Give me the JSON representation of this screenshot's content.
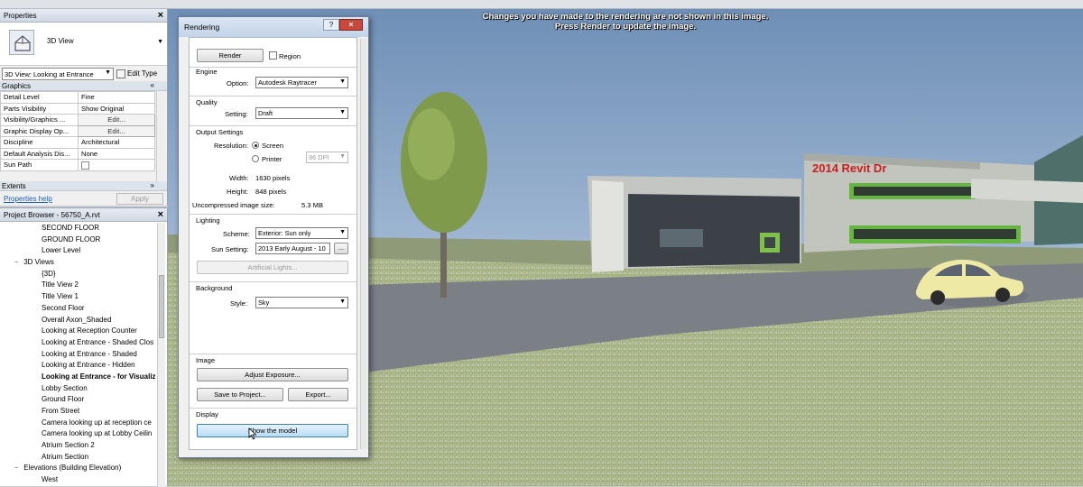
{
  "properties": {
    "title": "Properties",
    "type_name": "3D View",
    "view_selector": "3D View: Looking at Entrance",
    "edit_type": "Edit Type",
    "section_graphics": "Graphics",
    "rows": [
      {
        "key": "Detail Level",
        "value": "Fine"
      },
      {
        "key": "Parts Visibility",
        "value": "Show Original"
      },
      {
        "key": "Visibility/Graphics ...",
        "value": "Edit..."
      },
      {
        "key": "Graphic Display Op...",
        "value": "Edit..."
      },
      {
        "key": "Discipline",
        "value": "Architectural"
      },
      {
        "key": "Default Analysis Dis...",
        "value": "None"
      },
      {
        "key": "Sun Path",
        "value": ""
      }
    ],
    "section_extents": "Extents",
    "help_link": "Properties help",
    "apply": "Apply"
  },
  "browser": {
    "title": "Project Browser - 56750_A.rvt",
    "items": [
      {
        "label": "SECOND FLOOR",
        "indent": 3
      },
      {
        "label": "GROUND FLOOR",
        "indent": 3
      },
      {
        "label": "Lower Level",
        "indent": 3
      },
      {
        "label": "3D Views",
        "indent": 1,
        "toggle": "−"
      },
      {
        "label": "{3D}",
        "indent": 3
      },
      {
        "label": "Title View 2",
        "indent": 3
      },
      {
        "label": "Title View 1",
        "indent": 3
      },
      {
        "label": "Second Floor",
        "indent": 3
      },
      {
        "label": "Overall Axon_Shaded",
        "indent": 3
      },
      {
        "label": "Looking at Reception Counter",
        "indent": 3
      },
      {
        "label": "Looking at Entrance - Shaded Clos",
        "indent": 3
      },
      {
        "label": "Looking at Entrance - Shaded",
        "indent": 3
      },
      {
        "label": "Looking at Entrance - Hidden",
        "indent": 3
      },
      {
        "label": "Looking at Entrance - for Visualiz",
        "indent": 3,
        "bold": true
      },
      {
        "label": "Lobby Section",
        "indent": 3
      },
      {
        "label": "Ground Floor",
        "indent": 3
      },
      {
        "label": "From Street",
        "indent": 3
      },
      {
        "label": "Camera looking up at reception ce",
        "indent": 3
      },
      {
        "label": "Camera looking up at Lobby Ceilin",
        "indent": 3
      },
      {
        "label": "Atrium Section 2",
        "indent": 3
      },
      {
        "label": "Atrium Section",
        "indent": 3
      },
      {
        "label": "Elevations (Building Elevation)",
        "indent": 1,
        "toggle": "−"
      },
      {
        "label": "West",
        "indent": 3
      }
    ]
  },
  "viewport": {
    "message_line1": "Changes you have made to the rendering are not shown in this image.",
    "message_line2": "Press Render to update the image.",
    "sign_text": "2014 Revit Dr"
  },
  "dialog": {
    "title": "Rendering",
    "help": "?",
    "render_button": "Render",
    "region_label": "Region",
    "engine_head": "Engine",
    "option_label": "Option:",
    "option_value": "Autodesk Raytracer",
    "quality_head": "Quality",
    "setting_label": "Setting:",
    "setting_value": "Draft",
    "output_head": "Output Settings",
    "resolution_label": "Resolution:",
    "screen_label": "Screen",
    "printer_label": "Printer",
    "dpi_value": "96 DPI",
    "width_label": "Width:",
    "width_value": "1630 pixels",
    "height_label": "Height:",
    "height_value": "848 pixels",
    "size_label": "Uncompressed image size:",
    "size_value": "5.3 MB",
    "lighting_head": "Lighting",
    "scheme_label": "Scheme:",
    "scheme_value": "Exterior: Sun only",
    "sun_label": "Sun Setting:",
    "sun_value": "2013 Early August - 10",
    "sun_browse": "...",
    "artificial_lights": "Artificial Lights...",
    "background_head": "Background",
    "style_label": "Style:",
    "style_value": "Sky",
    "image_head": "Image",
    "adjust_exposure": "Adjust Exposure...",
    "save_to_project": "Save to Project...",
    "export": "Export...",
    "display_head": "Display",
    "show_model": "Show the model"
  }
}
